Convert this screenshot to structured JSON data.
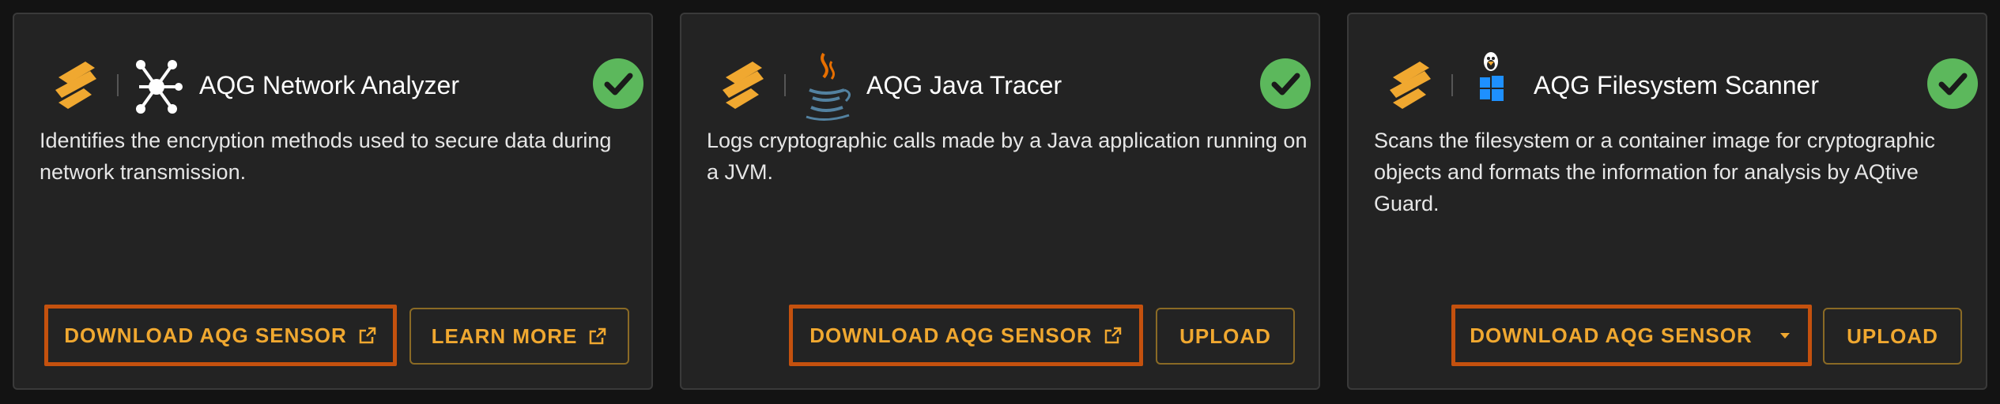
{
  "cards": [
    {
      "title": "AQG Network Analyzer",
      "icon": "network-nodes-icon",
      "status": "success",
      "description": "Identifies the encryption methods used to secure data during network transmission.",
      "buttons": [
        {
          "label": "DOWNLOAD AQG SENSOR",
          "icon": "external-link-icon",
          "highlighted": true
        },
        {
          "label": "LEARN MORE",
          "icon": "external-link-icon",
          "highlighted": false
        }
      ]
    },
    {
      "title": "AQG Java Tracer",
      "icon": "java-icon",
      "status": "success",
      "description": "Logs cryptographic calls made by a Java application running on a JVM.",
      "buttons": [
        {
          "label": "DOWNLOAD AQG SENSOR",
          "icon": "external-link-icon",
          "highlighted": true
        },
        {
          "label": "UPLOAD",
          "icon": "",
          "highlighted": false
        }
      ]
    },
    {
      "title": "AQG Filesystem Scanner",
      "icon": "linux-windows-icon",
      "status": "success",
      "description": "Scans the filesystem or a container image for cryptographic objects and formats the information for analysis by AQtive Guard.",
      "buttons": [
        {
          "label": "DOWNLOAD AQG SENSOR",
          "icon": "dropdown-caret-icon",
          "highlighted": true
        },
        {
          "label": "UPLOAD",
          "icon": "",
          "highlighted": false
        }
      ]
    }
  ],
  "colors": {
    "background": "#131313",
    "card": "#232323",
    "accent": "#f0a830",
    "highlight_border": "#c4510e",
    "success": "#5cb85c"
  }
}
